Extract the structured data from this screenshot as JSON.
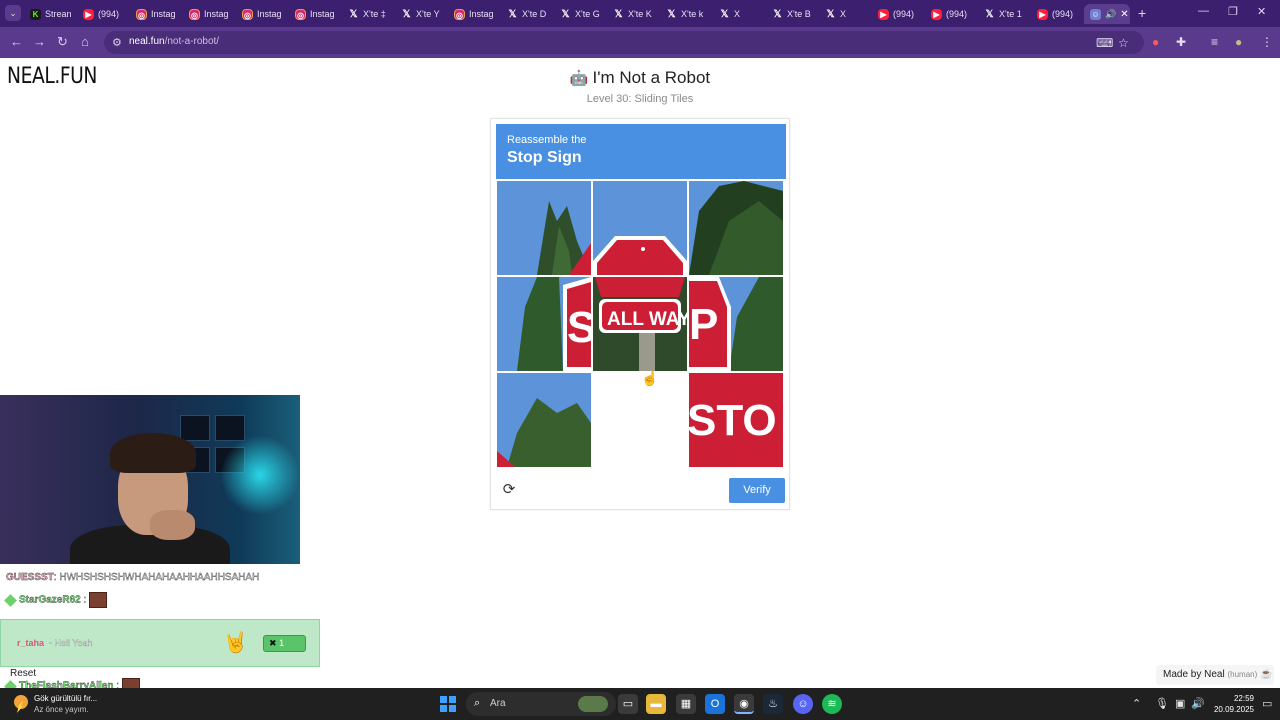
{
  "browser": {
    "tabs": [
      {
        "label": "Strean",
        "icon": "kick-icon"
      },
      {
        "label": "(994)",
        "icon": "youtube-icon"
      },
      {
        "label": "Instag",
        "icon": "instagram-icon"
      },
      {
        "label": "Instag",
        "icon": "instagram-icon"
      },
      {
        "label": "Instag",
        "icon": "instagram-icon"
      },
      {
        "label": "Instag",
        "icon": "instagram-icon"
      },
      {
        "label": "X'te ‡",
        "icon": "x-icon"
      },
      {
        "label": "X'te Y",
        "icon": "x-icon"
      },
      {
        "label": "Instag",
        "icon": "instagram-icon"
      },
      {
        "label": "X'te D",
        "icon": "x-icon"
      },
      {
        "label": "X'te G",
        "icon": "x-icon"
      },
      {
        "label": "X'te K",
        "icon": "x-icon"
      },
      {
        "label": "X'te k",
        "icon": "x-icon"
      },
      {
        "label": "X",
        "icon": "x-icon"
      },
      {
        "label": "X'te B",
        "icon": "x-icon"
      },
      {
        "label": "X",
        "icon": "x-icon"
      },
      {
        "label": "(994)",
        "icon": "youtube-icon"
      },
      {
        "label": "(994)",
        "icon": "youtube-icon"
      },
      {
        "label": "X'te 1",
        "icon": "x-icon"
      },
      {
        "label": "(994)",
        "icon": "youtube-icon"
      }
    ],
    "url_host": "neal.fun",
    "url_path": "/not-a-robot/"
  },
  "page": {
    "logo": "NEAL.FUN",
    "title": "I'm Not a Robot",
    "level": "Level 30: Sliding Tiles",
    "captcha": {
      "instruction": "Reassemble the",
      "target": "Stop Sign",
      "verify_label": "Verify",
      "tiles": [
        "sky-tree-left",
        "sign-top",
        "tree-right",
        "tree-sign-s",
        "sign-all-way",
        "sign-p-tree",
        "tree-bottom-left",
        "empty",
        "sign-sto"
      ],
      "empty_slot": 8
    },
    "made_by": "Made by Neal",
    "made_by_note": "(human)",
    "reset_label": "Reset"
  },
  "chat": {
    "line1_user": "GUESSST",
    "line1_text": ": HWHSHSHSHWHAHAHAAHHAAHHSAHAH",
    "line2_user": "StarGazeR62",
    "line2_sep": ":",
    "highlight_user": "r_taha",
    "highlight_text": "- Hell Yeah",
    "highlight_badge": "1",
    "line3_user": "TheFlashBarryAllen",
    "line3_sep": ":"
  },
  "taskbar": {
    "weather_title": "Gök gürültülü fır...",
    "weather_sub": "Az önce yayım.",
    "search_placeholder": "Ara",
    "time": "22:59",
    "date": "20.09.2025"
  },
  "colors": {
    "captcha_blue": "#4a90e2",
    "browser_purple": "#5a3a8c",
    "stop_red": "#cc1f36"
  }
}
